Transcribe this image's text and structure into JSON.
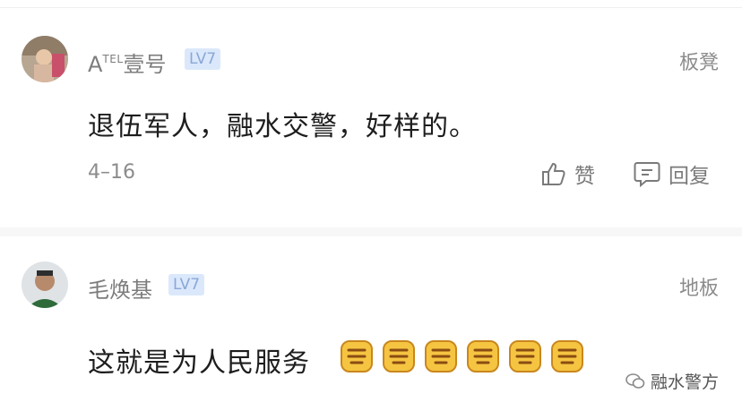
{
  "comments": [
    {
      "username": "A",
      "username_sup": "TEL",
      "username_rest": "壹号",
      "level": "LV7",
      "floor": "板凳",
      "text": "退伍军人，融水交警，好样的。",
      "date": "4–16",
      "like_label": "赞",
      "reply_label": "回复"
    },
    {
      "username": "毛焕基",
      "level": "LV7",
      "floor": "地板",
      "text": "这就是为人民服务",
      "emoji_count": 6,
      "emoji_name": "zan-emoji"
    }
  ],
  "watermark": {
    "label": "融水警方"
  },
  "colors": {
    "badge_bg": "#dbe8fb",
    "badge_text": "#8aa8d6",
    "meta": "#8c8c8c"
  }
}
